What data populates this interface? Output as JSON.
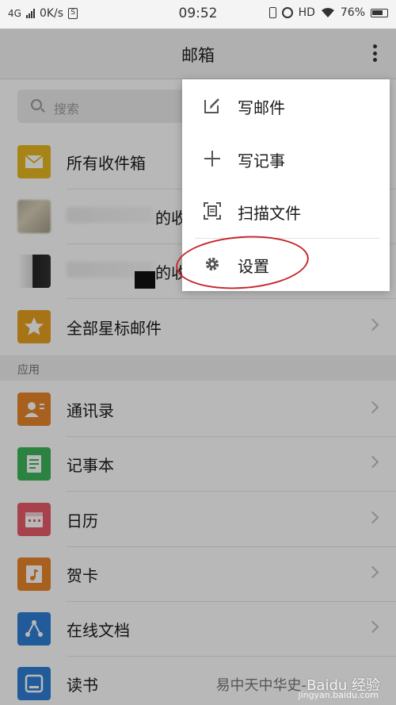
{
  "status_bar": {
    "network": "4G",
    "speed": "0K/s",
    "time": "09:52",
    "hd": "HD",
    "battery": "76%"
  },
  "header": {
    "title": "邮箱",
    "more_icon": "more-vertical-icon"
  },
  "search": {
    "placeholder": "搜索",
    "icon": "search-icon"
  },
  "mail_items": [
    {
      "label": "所有收件箱",
      "icon": "mail-icon",
      "color": "#e8b820"
    },
    {
      "label": "的收件箱",
      "icon": "account-avatar"
    },
    {
      "label": "的收件箱",
      "icon": "account-avatar"
    },
    {
      "label": "全部星标邮件",
      "icon": "star-icon",
      "color": "#e8a020"
    }
  ],
  "apps_section": {
    "header": "应用",
    "items": [
      {
        "label": "通讯录",
        "icon": "contacts-icon",
        "color": "#e8852a"
      },
      {
        "label": "记事本",
        "icon": "notepad-icon",
        "color": "#3cb55a"
      },
      {
        "label": "日历",
        "icon": "calendar-icon",
        "color": "#e85a6a"
      },
      {
        "label": "贺卡",
        "icon": "card-icon",
        "color": "#e8852a"
      },
      {
        "label": "在线文档",
        "icon": "document-icon",
        "color": "#2f7fd6"
      },
      {
        "label": "读书",
        "icon": "book-icon",
        "color": "#2f7fd6"
      }
    ]
  },
  "popup_menu": {
    "items": [
      {
        "label": "写邮件",
        "icon": "compose-icon"
      },
      {
        "label": "写记事",
        "icon": "plus-icon"
      },
      {
        "label": "扫描文件",
        "icon": "scan-icon"
      },
      {
        "label": "设置",
        "icon": "gear-icon"
      }
    ],
    "highlight_color": "#c8252b"
  },
  "watermark": {
    "text": "易中天中华史-",
    "logo_text": "Baidu 经验",
    "url": "jingyan.baidu.com"
  }
}
